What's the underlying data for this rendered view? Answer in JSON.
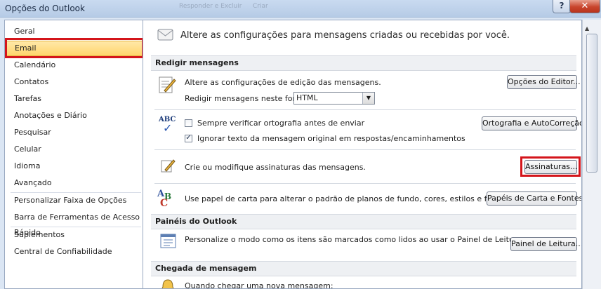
{
  "window": {
    "title": "Opções do Outlook",
    "ghost_title": "Responder e Excluir",
    "ghost_create": "Criar",
    "help_glyph": "?",
    "close_glyph": "✕"
  },
  "nav": {
    "items": [
      "Geral",
      "Email",
      "Calendário",
      "Contatos",
      "Tarefas",
      "Anotações e Diário",
      "Pesquisar",
      "Celular",
      "Idioma",
      "Avançado",
      "Personalizar Faixa de Opções",
      "Barra de Ferramentas de Acesso Rápido",
      "Suplementos",
      "Central de Confiabilidade"
    ],
    "selected": "Email"
  },
  "main": {
    "header": "Altere as configurações para mensagens criadas ou recebidas por você.",
    "sections": {
      "compose": "Redigir mensagens",
      "panes": "Painéis do Outlook",
      "arrival": "Chegada de mensagem"
    },
    "compose": {
      "editor_text": "Altere as configurações de edição das mensagens.",
      "format_label": "Redigir mensagens neste formato:",
      "format_value": "HTML",
      "editor_button": "Opções do Editor...",
      "spell_check": "Sempre verificar ortografia antes de enviar",
      "spell_checked": false,
      "ignore_original": "Ignorar texto da mensagem original em respostas/encaminhamentos",
      "ignore_checked": true,
      "spelling_button": "Ortografia e AutoCorreção...",
      "signatures_text": "Crie ou modifique assinaturas das mensagens.",
      "signatures_button": "Assinaturas...",
      "stationery_text": "Use papel de carta para alterar o padrão de planos de fundo, cores, estilos e fontes.",
      "stationery_button": "Papéis de Carta e Fontes..."
    },
    "panes": {
      "reading_text": "Personalize o modo como os itens são marcados como lidos ao usar o Painel de Leitura.",
      "reading_button": "Painel de Leitura..."
    },
    "arrival": {
      "new_message_text": "Quando chegar uma nova mensagem:"
    },
    "icons": {
      "abc": "ABC",
      "check": "✓",
      "dropdown": "▼",
      "scroll_up": "▲"
    }
  },
  "colors": {
    "highlight": "#d4151b",
    "selected": "#ffd56d"
  }
}
